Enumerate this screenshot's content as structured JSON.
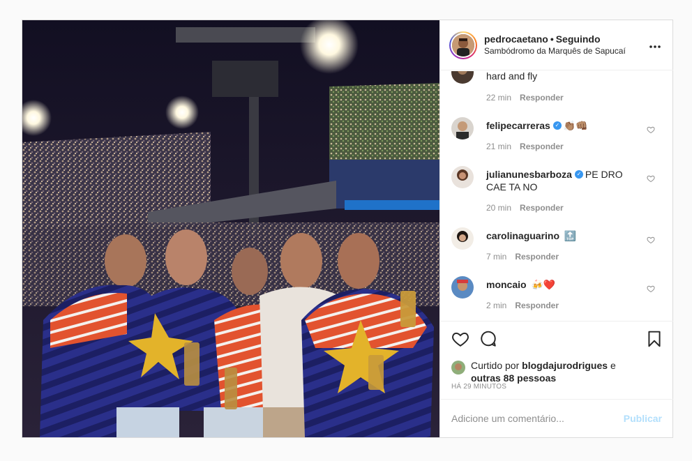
{
  "header": {
    "username": "pedrocaetano",
    "separator": "•",
    "follow_status": "Seguindo",
    "location": "Sambódromo da Marquês de Sapucaí",
    "options_icon": "more-horizontal-icon"
  },
  "comments": [
    {
      "username": "",
      "text": "hard and fly",
      "verified": false,
      "time": "22 min",
      "reply": "Responder",
      "has_likes_col": false
    },
    {
      "username": "felipecarreras",
      "text": "👏🏽👊🏽",
      "verified": true,
      "time": "21 min",
      "reply": "Responder"
    },
    {
      "username": "julianunesbarboza",
      "text": "PE DRO CAE TA NO",
      "verified": true,
      "time": "20 min",
      "reply": "Responder"
    },
    {
      "username": "carolinaguarino",
      "text": "🔝",
      "verified": false,
      "time": "7 min",
      "reply": "Responder"
    },
    {
      "username": "moncaio",
      "text": "🍻❤️",
      "verified": false,
      "time": "2 min",
      "reply": "Responder"
    }
  ],
  "actions": {
    "like_icon": "heart-icon",
    "comment_icon": "comment-icon",
    "save_icon": "bookmark-icon",
    "liked_prefix": "Curtido por",
    "liked_user": "blogdajurodrigues",
    "liked_and": "e",
    "liked_others": "outras 88 pessoas",
    "timestamp": "HÁ 29 MINUTOS"
  },
  "add_comment": {
    "placeholder": "Adicione um comentário...",
    "publish": "Publicar"
  },
  "colors": {
    "verified": "#3897f0",
    "publish_disabled": "#b2dffc",
    "meta_gray": "#8e8e8e"
  }
}
